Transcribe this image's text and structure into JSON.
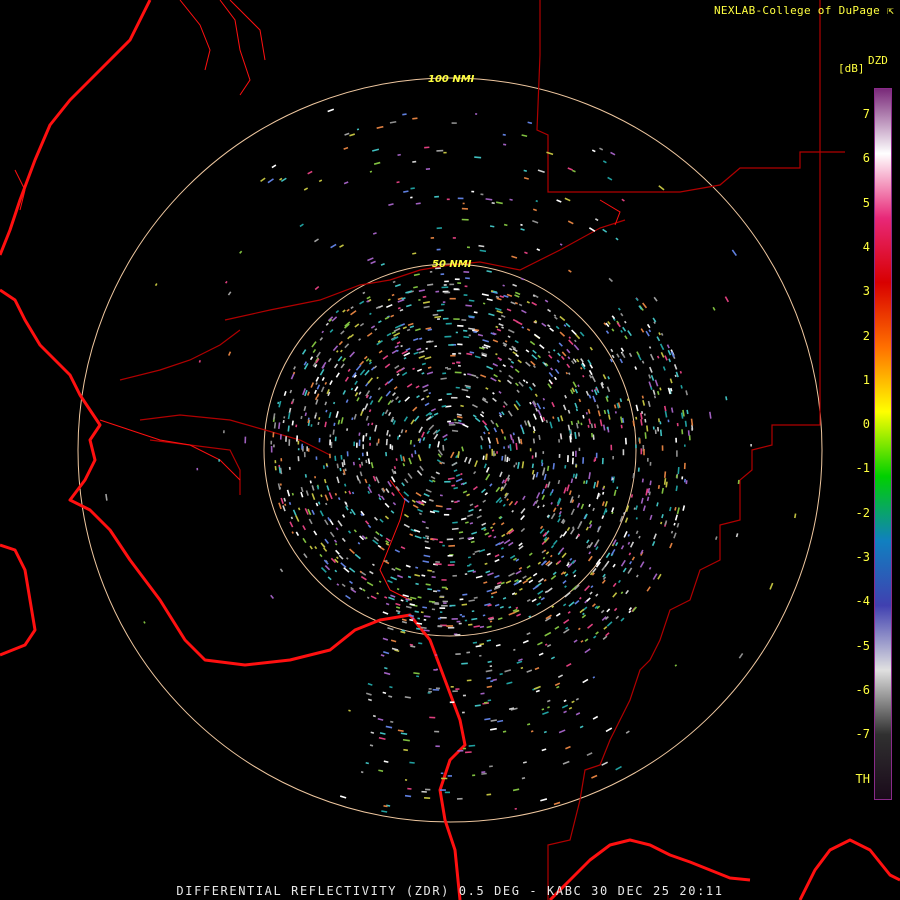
{
  "header": {
    "credit": "NEXLAB-College of DuPage"
  },
  "footer": {
    "caption": "DIFFERENTIAL REFLECTIVITY (ZDR) 0.5 DEG - KABC 30 DEC 25 20:11"
  },
  "legend": {
    "name": "DZD",
    "unit": "[dB]",
    "ticks": [
      "7",
      "6",
      "5",
      "4",
      "3",
      "2",
      "1",
      "0",
      "-1",
      "-2",
      "-3",
      "-4",
      "-5",
      "-6",
      "-7",
      "TH"
    ],
    "stops": [
      "#7a2a7a",
      "#ffffff",
      "#e82878",
      "#d80000",
      "#ff7000",
      "#ffff00",
      "#00d000",
      "#1080c0",
      "#4040b0",
      "#e0e0e0",
      "#303030",
      "#1a0a1a"
    ]
  },
  "map": {
    "rings": [
      {
        "label": "50 NMI"
      },
      {
        "label": "100 NMI"
      }
    ],
    "colors": {
      "ring": "#f0c8a0",
      "coast": "#ff1010",
      "border": "#b00000",
      "text": "#ffff40"
    }
  }
}
